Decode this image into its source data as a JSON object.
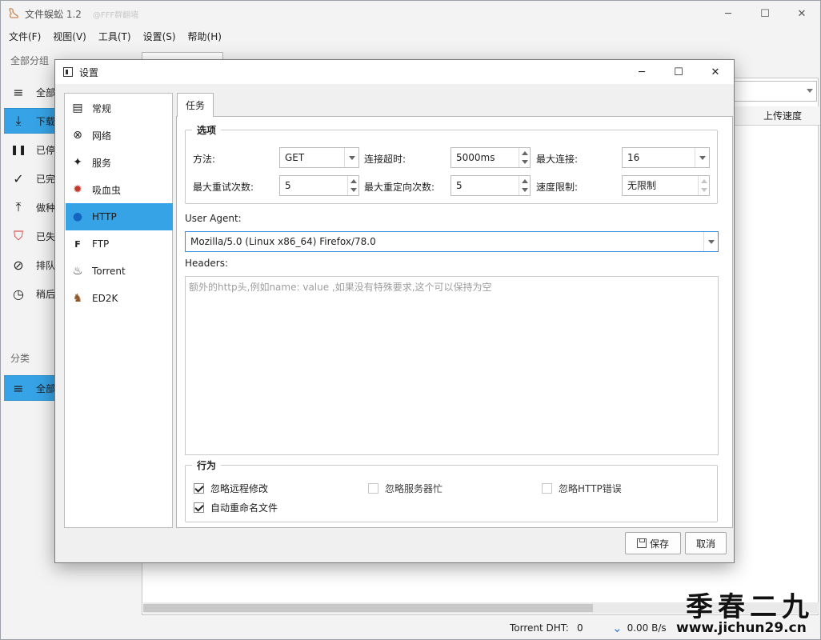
{
  "app": {
    "title": "文件蜈蚣 1.2",
    "subtitle": "@FFF群翻墙"
  },
  "window_controls": {
    "minimize": "─",
    "maximize": "☐",
    "close": "✕"
  },
  "menu": [
    "文件(F)",
    "视图(V)",
    "工具(T)",
    "设置(S)",
    "帮助(H)"
  ],
  "sidebar": {
    "group1_label": "全部分组",
    "items": [
      {
        "icon": "list-icon",
        "glyph": "≡",
        "label": "全部"
      },
      {
        "icon": "download-icon",
        "glyph": "⤓",
        "label": "下载"
      },
      {
        "icon": "pause-icon",
        "glyph": "❚❚",
        "label": "已停"
      },
      {
        "icon": "check-icon",
        "glyph": "✓",
        "label": "已完"
      },
      {
        "icon": "upload-icon",
        "glyph": "⤒",
        "label": "做种"
      },
      {
        "icon": "alert-shield-icon",
        "glyph": "⛉",
        "label": "已失"
      },
      {
        "icon": "compass-icon",
        "glyph": "⊘",
        "label": "排队"
      },
      {
        "icon": "clock-icon",
        "glyph": "◷",
        "label": "稍后"
      }
    ],
    "group2_label": "分类",
    "category_item": {
      "icon": "list-icon",
      "glyph": "≡",
      "label": "全部"
    }
  },
  "main": {
    "upload_speed_header": "上传速度"
  },
  "status": {
    "dht_label": "Torrent DHT:",
    "dht_value": "0",
    "download_speed": "0.00 B/s"
  },
  "watermark": {
    "big": "季春二九",
    "small": "www.jichun29.cn"
  },
  "dialog": {
    "title": "设置",
    "nav": [
      {
        "icon": "general-icon",
        "glyph": "▤",
        "label": "常规"
      },
      {
        "icon": "network-icon",
        "glyph": "⊗",
        "label": "网络"
      },
      {
        "icon": "service-wand-icon",
        "glyph": "✦",
        "label": "服务"
      },
      {
        "icon": "leech-bug-icon",
        "glyph": "✹",
        "label": "吸血虫"
      },
      {
        "icon": "globe-icon",
        "glyph": "●",
        "label": "HTTP"
      },
      {
        "icon": "ftp-icon",
        "glyph": "F",
        "label": "FTP"
      },
      {
        "icon": "torrent-flame-icon",
        "glyph": "♨",
        "label": "Torrent"
      },
      {
        "icon": "ed2k-mule-icon",
        "glyph": "♞",
        "label": "ED2K"
      }
    ],
    "active_nav": "HTTP",
    "tab": "任务",
    "options": {
      "title": "选项",
      "method_label": "方法:",
      "method_value": "GET",
      "timeout_label": "连接超时:",
      "timeout_value": "5000ms",
      "max_conn_label": "最大连接:",
      "max_conn_value": "16",
      "max_retry_label": "最大重试次数:",
      "max_retry_value": "5",
      "max_redirect_label": "最大重定向次数:",
      "max_redirect_value": "5",
      "speed_limit_label": "速度限制:",
      "speed_limit_value": "无限制"
    },
    "user_agent_label": "User Agent:",
    "user_agent_value": "Mozilla/5.0 (Linux x86_64) Firefox/78.0",
    "headers_label": "Headers:",
    "headers_placeholder": "额外的http头,例如name: value ,如果没有特殊要求,这个可以保持为空",
    "behavior": {
      "title": "行为",
      "ignore_remote_modify": {
        "label": "忽略远程修改",
        "checked": true
      },
      "ignore_server_busy": {
        "label": "忽略服务器忙",
        "checked": false
      },
      "ignore_http_error": {
        "label": "忽略HTTP错误",
        "checked": false
      },
      "auto_rename": {
        "label": "自动重命名文件",
        "checked": true
      }
    },
    "save_button": "保存",
    "cancel_button": "取消"
  }
}
